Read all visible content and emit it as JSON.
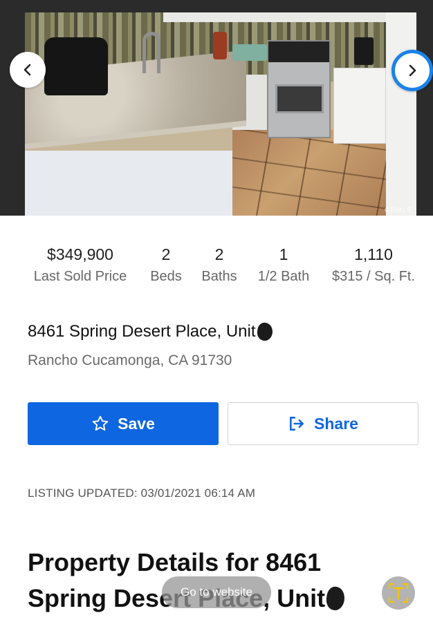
{
  "carousel": {
    "watermark": "CRMLS",
    "prev_icon": "chevron-left-icon",
    "next_icon": "chevron-right-icon",
    "active_ring_color": "#1a82e8"
  },
  "stats": [
    {
      "value": "$349,900",
      "label": "Last Sold Price"
    },
    {
      "value": "2",
      "label": "Beds"
    },
    {
      "value": "2",
      "label": "Baths"
    },
    {
      "value": "1",
      "label": "1/2 Bath"
    },
    {
      "value": "1,110",
      "label": "$315 / Sq. Ft."
    }
  ],
  "address": {
    "street": "8461 Spring Desert Place, Unit",
    "city": "Rancho Cucamonga, CA 91730"
  },
  "actions": {
    "save_label": "Save",
    "save_icon": "star-outline-icon",
    "share_label": "Share",
    "share_icon": "share-arrow-icon",
    "primary_color": "#0e66e0"
  },
  "listing_updated": "LISTING UPDATED: 03/01/2021 06:14 AM",
  "property_details": {
    "heading_line1": "Property Details for 8461",
    "heading_line2": "Spring Desert Place, Unit"
  },
  "overlay": {
    "go_to_website": "Go to website",
    "text_scan_icon": "text-recognition-icon"
  }
}
